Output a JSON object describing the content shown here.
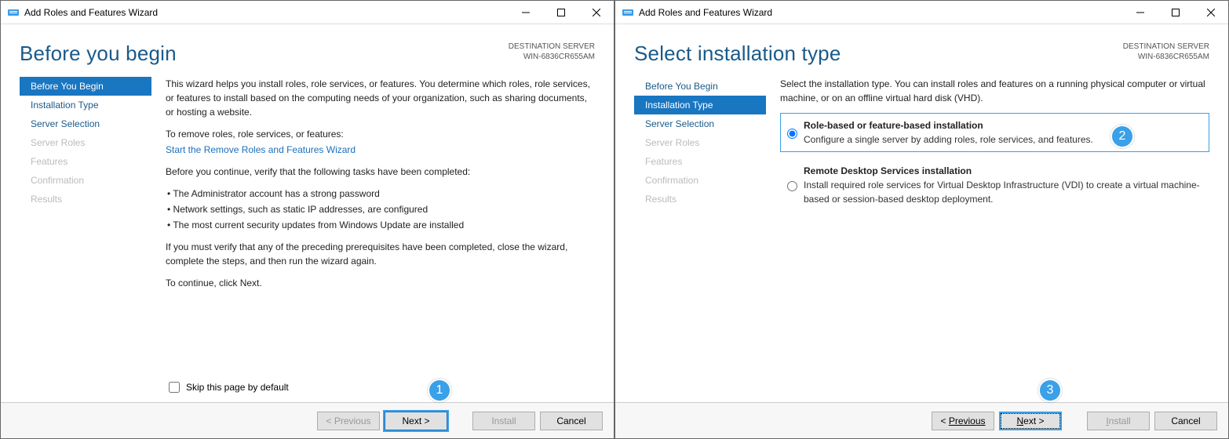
{
  "window1": {
    "title": "Add Roles and Features Wizard",
    "page_title": "Before you begin",
    "dest_label": "DESTINATION SERVER",
    "dest_value": "WIN-6836CR655AM",
    "sidebar": [
      {
        "label": "Before You Begin",
        "state": "selected"
      },
      {
        "label": "Installation Type",
        "state": "normal"
      },
      {
        "label": "Server Selection",
        "state": "normal"
      },
      {
        "label": "Server Roles",
        "state": "disabled"
      },
      {
        "label": "Features",
        "state": "disabled"
      },
      {
        "label": "Confirmation",
        "state": "disabled"
      },
      {
        "label": "Results",
        "state": "disabled"
      }
    ],
    "intro": "This wizard helps you install roles, role services, or features. You determine which roles, role services, or features to install based on the computing needs of your organization, such as sharing documents, or hosting a website.",
    "remove_label": "To remove roles, role services, or features:",
    "remove_link": "Start the Remove Roles and Features Wizard",
    "verify_label": "Before you continue, verify that the following tasks have been completed:",
    "bullets": [
      "The Administrator account has a strong password",
      "Network settings, such as static IP addresses, are configured",
      "The most current security updates from Windows Update are installed"
    ],
    "verify_note": "If you must verify that any of the preceding prerequisites have been completed, close the wizard, complete the steps, and then run the wizard again.",
    "continue_note": "To continue, click Next.",
    "skip_label": "Skip this page by default",
    "buttons": {
      "prev": "< Previous",
      "next": "Next >",
      "install": "Install",
      "cancel": "Cancel"
    }
  },
  "window2": {
    "title": "Add Roles and Features Wizard",
    "page_title": "Select installation type",
    "dest_label": "DESTINATION SERVER",
    "dest_value": "WIN-6836CR655AM",
    "sidebar": [
      {
        "label": "Before You Begin",
        "state": "normal"
      },
      {
        "label": "Installation Type",
        "state": "selected"
      },
      {
        "label": "Server Selection",
        "state": "normal"
      },
      {
        "label": "Server Roles",
        "state": "disabled"
      },
      {
        "label": "Features",
        "state": "disabled"
      },
      {
        "label": "Confirmation",
        "state": "disabled"
      },
      {
        "label": "Results",
        "state": "disabled"
      }
    ],
    "intro": "Select the installation type. You can install roles and features on a running physical computer or virtual machine, or on an offline virtual hard disk (VHD).",
    "options": [
      {
        "title": "Role-based or feature-based installation",
        "desc": "Configure a single server by adding roles, role services, and features.",
        "selected": true
      },
      {
        "title": "Remote Desktop Services installation",
        "desc": "Install required role services for Virtual Desktop Infrastructure (VDI) to create a virtual machine-based or session-based desktop deployment.",
        "selected": false
      }
    ],
    "buttons": {
      "prev": "Previous",
      "next": "Next >",
      "install": "Install",
      "cancel": "Cancel"
    }
  },
  "callouts": {
    "c1": "1",
    "c2": "2",
    "c3": "3"
  }
}
